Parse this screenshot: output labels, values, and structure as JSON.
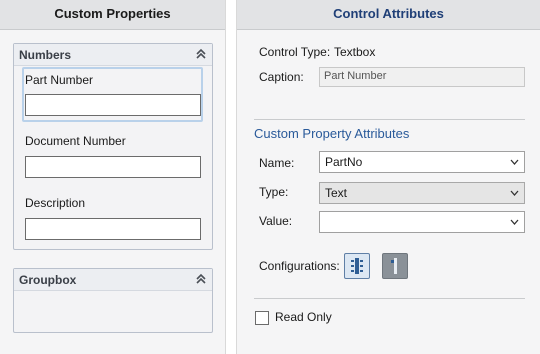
{
  "left_panel": {
    "title": "Custom Properties",
    "groups": [
      {
        "title": "Numbers",
        "fields": [
          {
            "label": "Part Number",
            "value": ""
          },
          {
            "label": "Document Number",
            "value": ""
          },
          {
            "label": "Description",
            "value": ""
          }
        ]
      },
      {
        "title": "Groupbox"
      }
    ]
  },
  "right_panel": {
    "title": "Control Attributes",
    "control_type_label": "Control Type:",
    "control_type_value": "Textbox",
    "caption_label": "Caption:",
    "caption_value": "Part Number",
    "section_title": "Custom Property Attributes",
    "name_label": "Name:",
    "name_value": "PartNo",
    "type_label": "Type:",
    "type_value": "Text",
    "value_label": "Value:",
    "value_value": "",
    "configurations_label": "Configurations:",
    "read_only_label": "Read Only",
    "read_only_checked": false
  },
  "colors": {
    "right_title": "#1f3f77",
    "section_title": "#2a5a9a",
    "selection_frame": "#b9d1ea"
  }
}
